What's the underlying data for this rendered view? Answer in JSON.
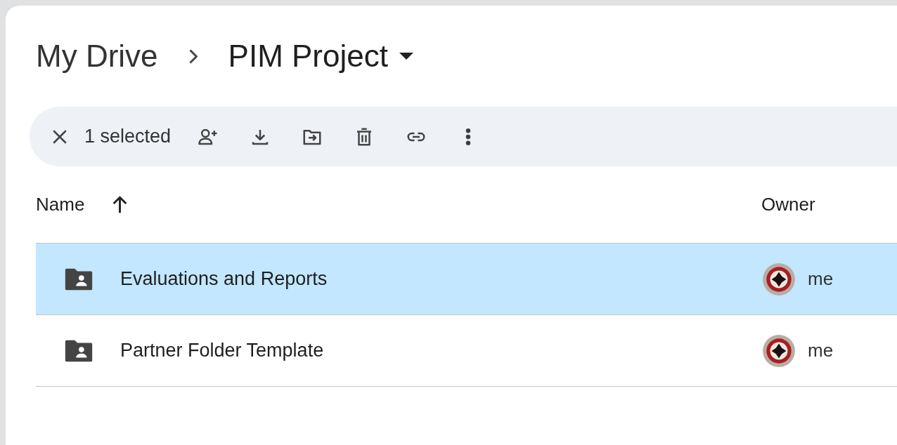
{
  "breadcrumb": {
    "root": "My Drive",
    "current": "PIM Project",
    "has_menu": true
  },
  "selection_bar": {
    "count": "1 selected",
    "actions": [
      {
        "kind": "share"
      },
      {
        "kind": "download"
      },
      {
        "kind": "move"
      },
      {
        "kind": "delete"
      },
      {
        "kind": "link"
      },
      {
        "kind": "more"
      }
    ]
  },
  "table": {
    "columns": [
      {
        "label": "Name",
        "sort_ascending": true
      },
      {
        "label": "Owner"
      }
    ],
    "rows": [
      {
        "name": "Evaluations and Reports",
        "owner": "me",
        "selected": true
      },
      {
        "name": "Partner Folder Template",
        "owner": "me",
        "selected": false
      }
    ]
  }
}
